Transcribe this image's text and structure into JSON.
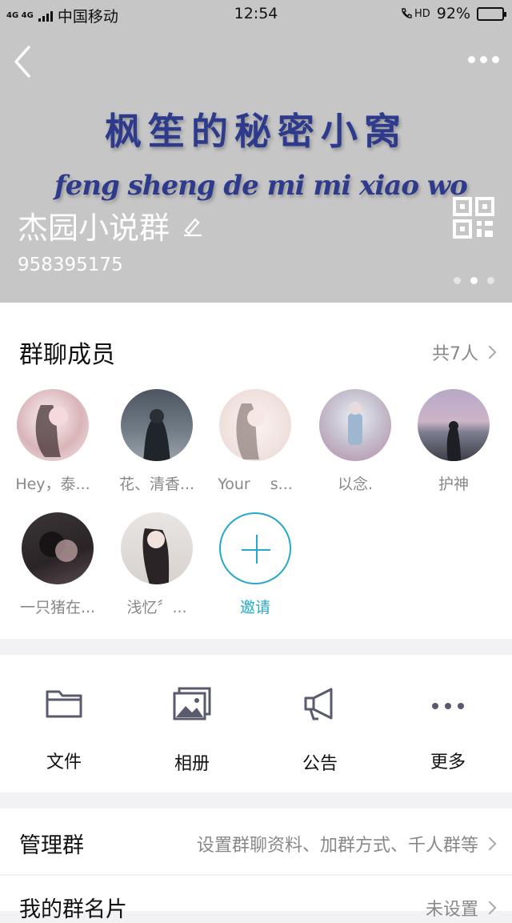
{
  "status_bar": {
    "network": "4G 4G",
    "carrier": "中国移动",
    "time": "12:54",
    "hd": "HD",
    "battery": "92%",
    "battery_level": 0.92
  },
  "hero": {
    "banner_line1": "枫笙的秘密小窝",
    "banner_line2": "feng sheng de mi mi xiao wo",
    "group_name": "杰园小说群",
    "group_id": "958395175",
    "page_count": 3,
    "current_page": 2
  },
  "members": {
    "title": "群聊成员",
    "count": "共7人",
    "list": [
      {
        "name": "Hey，泰..."
      },
      {
        "name": "花、清香..."
      },
      {
        "name": "Your　 s..."
      },
      {
        "name": "以念."
      },
      {
        "name": "护神"
      },
      {
        "name": "一只猪在..."
      },
      {
        "name": "浅忆〞..."
      }
    ],
    "invite": "邀请"
  },
  "actions": [
    {
      "label": "文件",
      "icon": "folder-icon"
    },
    {
      "label": "相册",
      "icon": "photo-album-icon"
    },
    {
      "label": "公告",
      "icon": "megaphone-icon"
    },
    {
      "label": "更多",
      "icon": "more-dots-icon"
    }
  ],
  "rows": {
    "manage": {
      "title": "管理群",
      "value": "设置群聊资料、加群方式、千人群等"
    },
    "card": {
      "title": "我的群名片",
      "value": "未设置"
    }
  },
  "colors": {
    "accent": "#25a9c9",
    "banner_text": "#2e3b8c",
    "hero_bg": "#c6c6c6"
  }
}
